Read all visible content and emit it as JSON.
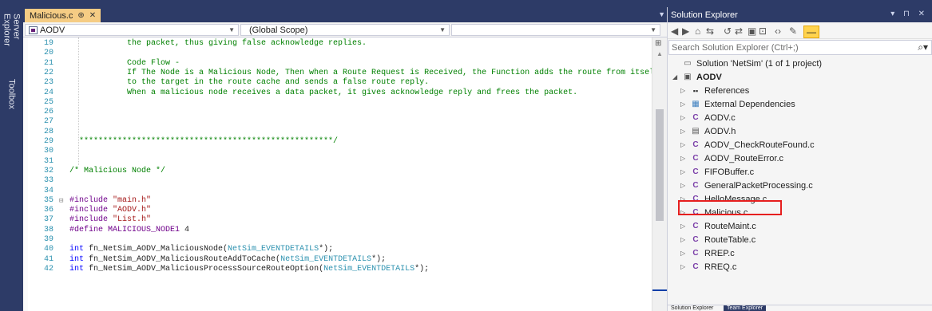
{
  "left_strip": {
    "server_explorer": "Server Explorer",
    "toolbox": "Toolbox"
  },
  "doc_tab": {
    "label": "Malicious.c",
    "pin": "⊕",
    "close": "✕"
  },
  "nav": {
    "project": "AODV",
    "scope": "(Global Scope)",
    "member": ""
  },
  "code_lines": [
    {
      "n": "19",
      "segs": [
        {
          "c": "comment",
          "t": "            the packet, thus giving false acknowledge replies."
        }
      ]
    },
    {
      "n": "20",
      "segs": []
    },
    {
      "n": "21",
      "segs": [
        {
          "c": "comment",
          "t": "            Code Flow -"
        }
      ]
    },
    {
      "n": "22",
      "segs": [
        {
          "c": "comment",
          "t": "            If The Node is a Malicious Node, Then when a Route Request is Received, the Function adds the route from itself"
        }
      ]
    },
    {
      "n": "23",
      "segs": [
        {
          "c": "comment",
          "t": "            to the target in the route cache and sends a false route reply."
        }
      ]
    },
    {
      "n": "24",
      "segs": [
        {
          "c": "comment",
          "t": "            When a malicious node receives a data packet, it gives acknowledge reply and frees the packet."
        }
      ]
    },
    {
      "n": "25",
      "segs": []
    },
    {
      "n": "26",
      "segs": []
    },
    {
      "n": "27",
      "segs": []
    },
    {
      "n": "28",
      "segs": []
    },
    {
      "n": "29",
      "segs": [
        {
          "c": "comment",
          "t": "  *****************************************************/"
        }
      ]
    },
    {
      "n": "30",
      "segs": []
    },
    {
      "n": "31",
      "segs": []
    },
    {
      "n": "32",
      "segs": [
        {
          "c": "comment",
          "t": "/* Malicious Node */"
        }
      ]
    },
    {
      "n": "33",
      "segs": []
    },
    {
      "n": "34",
      "segs": []
    },
    {
      "n": "35",
      "fold": "⊟",
      "segs": [
        {
          "c": "macro",
          "t": "#include "
        },
        {
          "c": "str",
          "t": "\"main.h\""
        }
      ]
    },
    {
      "n": "36",
      "segs": [
        {
          "c": "macro",
          "t": "#include "
        },
        {
          "c": "str",
          "t": "\"AODV.h\""
        }
      ]
    },
    {
      "n": "37",
      "segs": [
        {
          "c": "macro",
          "t": "#include "
        },
        {
          "c": "str",
          "t": "\"List.h\""
        }
      ]
    },
    {
      "n": "38",
      "segs": [
        {
          "c": "macro",
          "t": "#define "
        },
        {
          "c": "macro",
          "t": "MALICIOUS_NODE1"
        },
        {
          "c": "plain",
          "t": " 4"
        }
      ]
    },
    {
      "n": "39",
      "segs": []
    },
    {
      "n": "40",
      "segs": [
        {
          "c": "kw",
          "t": "int"
        },
        {
          "c": "plain",
          "t": " fn_NetSim_AODV_MaliciousNode("
        },
        {
          "c": "type",
          "t": "NetSim_EVENTDETAILS"
        },
        {
          "c": "plain",
          "t": "*);"
        }
      ]
    },
    {
      "n": "41",
      "segs": [
        {
          "c": "kw",
          "t": "int"
        },
        {
          "c": "plain",
          "t": " fn_NetSim_AODV_MaliciousRouteAddToCache("
        },
        {
          "c": "type",
          "t": "NetSim_EVENTDETAILS"
        },
        {
          "c": "plain",
          "t": "*);"
        }
      ]
    },
    {
      "n": "42",
      "segs": [
        {
          "c": "kw",
          "t": "int"
        },
        {
          "c": "plain",
          "t": " fn_NetSim_AODV_MaliciousProcessSourceRouteOption("
        },
        {
          "c": "type",
          "t": "NetSim_EVENTDETAILS"
        },
        {
          "c": "plain",
          "t": "*);"
        }
      ]
    }
  ],
  "solution_explorer": {
    "title": "Solution Explorer",
    "title_controls": "▾ ⊓ ✕",
    "search_placeholder": "Search Solution Explorer (Ctrl+;)",
    "toolbar": [
      "◀",
      "▶",
      "⌂",
      "⇆",
      "↺",
      "⇄",
      "▣",
      "⊡",
      "‹›",
      "✎",
      "—"
    ],
    "tree": [
      {
        "label": "Solution 'NetSim' (1 of 1 project)",
        "level": 0,
        "icon": "solution-icon",
        "glyph": "▭",
        "exp": ""
      },
      {
        "label": "AODV",
        "level": 0,
        "icon": "project-icon",
        "glyph": "▣",
        "exp": "◢",
        "bold": true
      },
      {
        "label": "References",
        "level": 1,
        "icon": "references-icon",
        "glyph": "▪▪",
        "exp": "▷"
      },
      {
        "label": "External Dependencies",
        "level": 1,
        "icon": "external-deps-icon",
        "glyph": "▦",
        "exp": "▷"
      },
      {
        "label": "AODV.c",
        "level": 1,
        "icon": "c-file-icon",
        "glyph": "C",
        "exp": "▷"
      },
      {
        "label": "AODV.h",
        "level": 1,
        "icon": "h-file-icon",
        "glyph": "▤",
        "exp": "▷"
      },
      {
        "label": "AODV_CheckRouteFound.c",
        "level": 1,
        "icon": "c-file-icon",
        "glyph": "C",
        "exp": "▷"
      },
      {
        "label": "AODV_RouteError.c",
        "level": 1,
        "icon": "c-file-icon",
        "glyph": "C",
        "exp": "▷"
      },
      {
        "label": "FIFOBuffer.c",
        "level": 1,
        "icon": "c-file-icon",
        "glyph": "C",
        "exp": "▷"
      },
      {
        "label": "GeneralPacketProcessing.c",
        "level": 1,
        "icon": "c-file-icon",
        "glyph": "C",
        "exp": "▷"
      },
      {
        "label": "HelloMessage.c",
        "level": 1,
        "icon": "c-file-icon",
        "glyph": "C",
        "exp": "▷"
      },
      {
        "label": "Malicious.c",
        "level": 1,
        "icon": "c-file-icon",
        "glyph": "C",
        "exp": "▷",
        "highlight": true
      },
      {
        "label": "RouteMaint.c",
        "level": 1,
        "icon": "c-file-icon",
        "glyph": "C",
        "exp": "▷"
      },
      {
        "label": "RouteTable.c",
        "level": 1,
        "icon": "c-file-icon",
        "glyph": "C",
        "exp": "▷"
      },
      {
        "label": "RREP.c",
        "level": 1,
        "icon": "c-file-icon",
        "glyph": "C",
        "exp": "▷"
      },
      {
        "label": "RREQ.c",
        "level": 1,
        "icon": "c-file-icon",
        "glyph": "C",
        "exp": "▷"
      }
    ],
    "bottom_tabs": [
      "Solution Explorer",
      "Team Explorer"
    ]
  },
  "colors": {
    "chrome": "#2d3b67",
    "active_tab": "#f5cc84",
    "highlight": "#e61f1f"
  }
}
